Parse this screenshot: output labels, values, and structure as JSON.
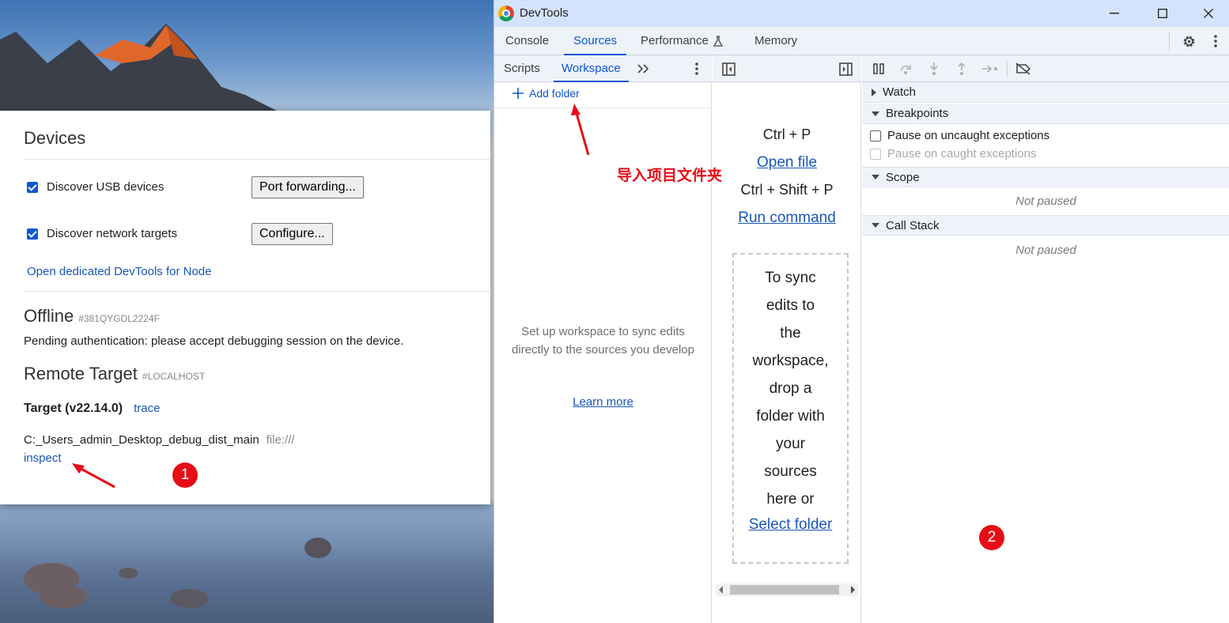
{
  "inspect_page": {
    "devices_title": "Devices",
    "discover_usb_label": "Discover USB devices",
    "port_forwarding_button": "Port forwarding...",
    "discover_network_label": "Discover network targets",
    "configure_button": "Configure...",
    "node_devtools_link": "Open dedicated DevTools for Node",
    "offline_title": "Offline",
    "offline_id": "#381QYGDL2224F",
    "pending_text": "Pending authentication: please accept debugging session on the device.",
    "remote_target_title": "Remote Target",
    "remote_target_id": "#LOCALHOST",
    "target_name": "Target (v22.14.0)",
    "trace_link": "trace",
    "target_path": "C:_Users_admin_Desktop_debug_dist_main",
    "target_url": "file:///",
    "inspect_link": "inspect"
  },
  "annotations": {
    "badge_1": "1",
    "badge_2": "2",
    "import_folder_note": "导入项目文件夹",
    "arrow_color": "#e60d17"
  },
  "devtools": {
    "window_title": "DevTools",
    "main_tabs": [
      {
        "label": "Console"
      },
      {
        "label": "Sources"
      },
      {
        "label": "Performance"
      },
      {
        "label": "Memory"
      }
    ],
    "active_main_tab": "Sources",
    "navigator": {
      "tabs": [
        {
          "label": "Scripts"
        },
        {
          "label": "Workspace"
        }
      ],
      "active_tab": "Workspace",
      "add_folder": "Add folder",
      "empty_message": "Set up workspace to sync edits directly to the sources you develop",
      "learn_more": "Learn more"
    },
    "editor": {
      "shortcut_open": "Ctrl + P",
      "open_file": "Open file",
      "shortcut_run": "Ctrl + Shift + P",
      "run_command": "Run command",
      "drop_lines": [
        "To sync",
        "edits to",
        "the",
        "workspace,",
        "drop a",
        "folder with",
        "your",
        "sources",
        "here or"
      ],
      "select_folder": "Select folder"
    },
    "debugger": {
      "watch": "Watch",
      "breakpoints": "Breakpoints",
      "pause_uncaught": "Pause on uncaught exceptions",
      "pause_caught": "Pause on caught exceptions",
      "scope": "Scope",
      "scope_status": "Not paused",
      "call_stack": "Call Stack",
      "call_stack_status": "Not paused"
    },
    "accent_color": "#0b57d0"
  }
}
